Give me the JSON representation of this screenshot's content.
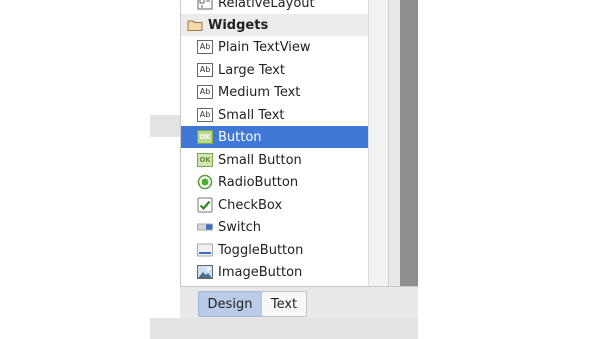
{
  "palette": {
    "items": [
      {
        "label": "RelativeLayout",
        "icon": "relative-layout-icon"
      },
      {
        "label": "Widgets",
        "icon": "folder-icon"
      },
      {
        "label": "Plain TextView",
        "icon": "ab-text-icon"
      },
      {
        "label": "Large Text",
        "icon": "ab-text-icon"
      },
      {
        "label": "Medium Text",
        "icon": "ab-text-icon"
      },
      {
        "label": "Small Text",
        "icon": "ab-text-icon"
      },
      {
        "label": "Button",
        "icon": "ok-button-icon",
        "selected": true
      },
      {
        "label": "Small Button",
        "icon": "ok-button-icon"
      },
      {
        "label": "RadioButton",
        "icon": "radio-icon"
      },
      {
        "label": "CheckBox",
        "icon": "checkbox-icon"
      },
      {
        "label": "Switch",
        "icon": "switch-icon"
      },
      {
        "label": "ToggleButton",
        "icon": "toggle-icon"
      },
      {
        "label": "ImageButton",
        "icon": "image-icon"
      }
    ],
    "ab_glyph": "Ab",
    "ok_glyph": "OK"
  },
  "tabs": {
    "design": "Design",
    "text": "Text",
    "active": "Design"
  },
  "colors": {
    "selected": "#3f78d6",
    "active_tab": "#b9cbe6",
    "dark_strip": "#8e8e8e"
  }
}
